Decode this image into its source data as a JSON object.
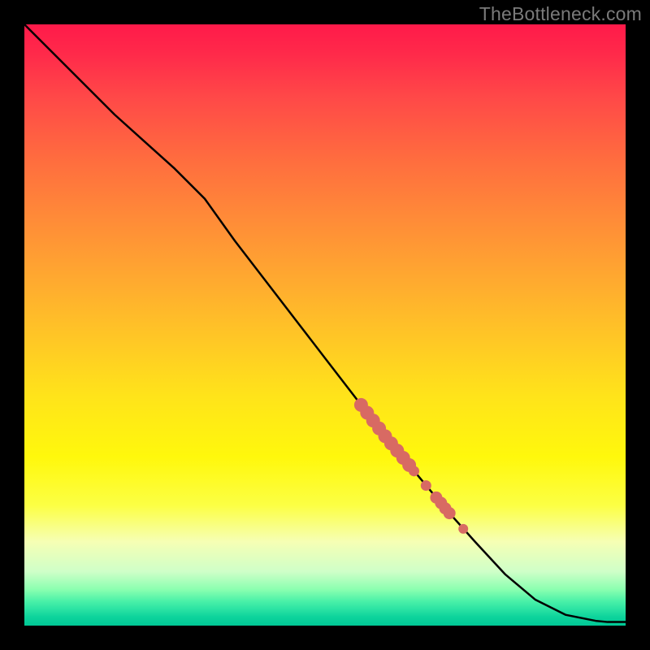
{
  "watermark": "TheBottleneck.com",
  "colors": {
    "line": "#000000",
    "marker_fill": "#d86a63",
    "marker_alt": "#de7870"
  },
  "chart_data": {
    "type": "line",
    "title": "",
    "xlabel": "",
    "ylabel": "",
    "xlim": [
      0,
      100
    ],
    "ylim": [
      0,
      100
    ],
    "grid": false,
    "legend": false,
    "series": [
      {
        "name": "curve",
        "x": [
          0,
          5,
          10,
          15,
          20,
          25,
          30,
          35,
          40,
          45,
          50,
          55,
          60,
          65,
          70,
          75,
          80,
          85,
          90,
          95,
          97,
          100
        ],
        "y": [
          100,
          95,
          90,
          85,
          80.5,
          76,
          71,
          64,
          57.5,
          51,
          44.5,
          38,
          31.5,
          25.5,
          19.5,
          13.9,
          8.5,
          4.3,
          1.8,
          0.8,
          0.6,
          0.6
        ]
      }
    ],
    "markers": {
      "name": "highlight-points",
      "x": [
        56,
        57,
        58,
        59,
        60,
        61,
        62,
        63,
        64,
        64.8,
        66.8,
        68.5,
        69.3,
        70.0,
        70.7,
        73.0
      ],
      "y": [
        36.7,
        35.4,
        34.1,
        32.8,
        31.5,
        30.3,
        29.1,
        27.9,
        26.7,
        25.7,
        23.3,
        21.3,
        20.4,
        19.5,
        18.7,
        16.1
      ],
      "size_hint": "thick-cluster"
    }
  }
}
